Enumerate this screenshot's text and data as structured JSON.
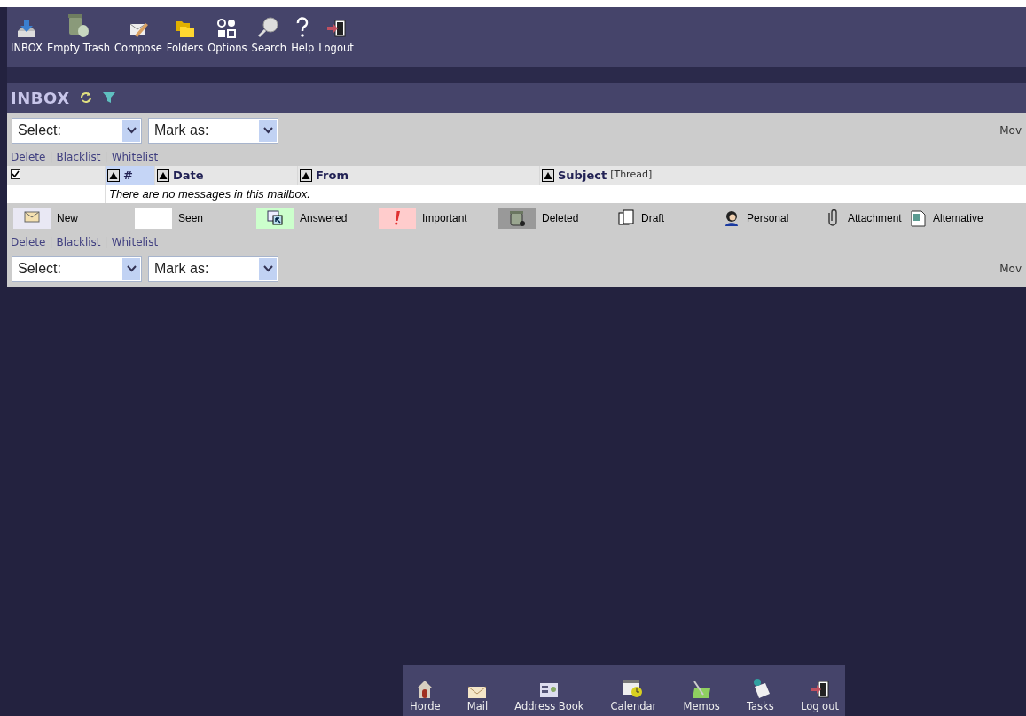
{
  "toolbar": [
    {
      "label": "INBOX",
      "kind": "inbox"
    },
    {
      "label": "Empty Trash",
      "kind": "trash"
    },
    {
      "label": "Compose",
      "kind": "compose"
    },
    {
      "label": "Folders",
      "kind": "folders"
    },
    {
      "label": "Options",
      "kind": "options"
    },
    {
      "label": "Search",
      "kind": "search"
    },
    {
      "label": "Help",
      "kind": "help"
    },
    {
      "label": "Logout",
      "kind": "logout"
    }
  ],
  "mailbox": {
    "title": "INBOX"
  },
  "controls_top": {
    "select": "Select:",
    "mark": "Mark as:",
    "move": "Mov"
  },
  "actions_top": [
    "Delete",
    "Blacklist",
    "Whitelist"
  ],
  "separator": "|",
  "select_all": {
    "checked": true
  },
  "columns": [
    {
      "label": "#",
      "selected": true
    },
    {
      "label": "Date",
      "selected": false
    },
    {
      "label": "From",
      "selected": false
    },
    {
      "label": "Subject",
      "extra": "[Thread]",
      "selected": false
    }
  ],
  "empty_message": "There are no messages in this mailbox.",
  "legend": [
    {
      "label": "New",
      "kind": "new",
      "color": "#e9e8f4"
    },
    {
      "label": "Seen",
      "kind": "seen",
      "color": "#ffffff"
    },
    {
      "label": "Answered",
      "kind": "answered",
      "color": "#ccffcc"
    },
    {
      "label": "Important",
      "kind": "important",
      "color": "#ffcccc"
    },
    {
      "label": "Deleted",
      "kind": "deleted",
      "color": "#999999"
    },
    {
      "label": "Draft",
      "kind": "draft"
    },
    {
      "label": "Personal",
      "kind": "personal"
    },
    {
      "label": "Attachment",
      "kind": "attachment"
    },
    {
      "label": "Alternative",
      "kind": "alternative"
    }
  ],
  "actions_bottom": [
    "Delete",
    "Blacklist",
    "Whitelist"
  ],
  "controls_bottom": {
    "select": "Select:",
    "mark": "Mark as:",
    "move": "Mov"
  },
  "app_bar": [
    {
      "label": "Horde",
      "kind": "home"
    },
    {
      "label": "Mail",
      "kind": "mail"
    },
    {
      "label": "Address Book",
      "kind": "addressbook"
    },
    {
      "label": "Calendar",
      "kind": "calendar"
    },
    {
      "label": "Memos",
      "kind": "memos"
    },
    {
      "label": "Tasks",
      "kind": "tasks"
    },
    {
      "label": "Log out",
      "kind": "logout"
    }
  ]
}
